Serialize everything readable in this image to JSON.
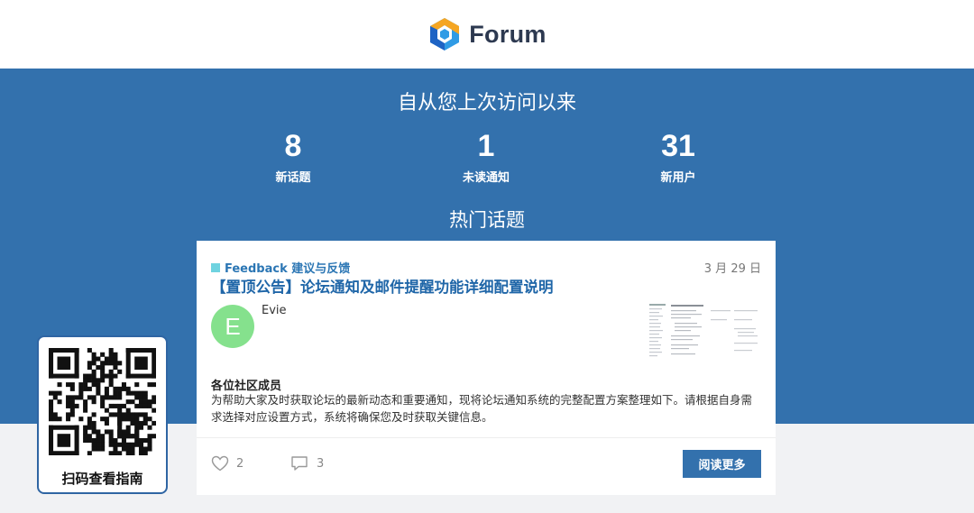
{
  "header": {
    "logo_text": "Forum",
    "logo_icon": "hexagon-logo-icon"
  },
  "hero": {
    "title": "自从您上次访问以来",
    "stats": [
      {
        "value": "8",
        "label": "新话题"
      },
      {
        "value": "1",
        "label": "未读通知"
      },
      {
        "value": "31",
        "label": "新用户"
      }
    ],
    "hot_title": "热门话题"
  },
  "topic": {
    "category": "Feedback 建议与反馈",
    "category_color": "#6fd3e0",
    "date": "3 月 29 日",
    "title": "【置顶公告】论坛通知及邮件提醒功能详细配置说明",
    "author_initial": "E",
    "author_name": "Evie",
    "excerpt_heading": "各位社区成员",
    "excerpt": "为帮助大家及时获取论坛的最新动态和重要通知，现将论坛通知系统的完整配置方案整理如下。请根据自身需求选择对应设置方式，系统将确保您及时获取关键信息。",
    "likes": "2",
    "replies": "3",
    "read_more": "阅读更多"
  },
  "qr": {
    "label": "扫码查看指南"
  },
  "colors": {
    "hero_bg": "#3371ad",
    "accent": "#1f66a8",
    "avatar": "#85e18d",
    "qr_border": "#2f65a3"
  }
}
